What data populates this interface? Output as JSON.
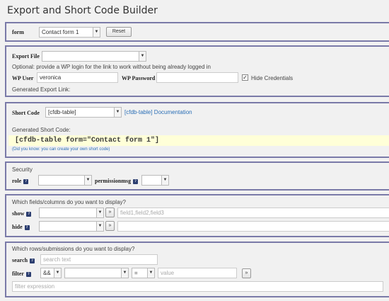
{
  "page": {
    "title": "Export and Short Code Builder"
  },
  "form_panel": {
    "form_label": "form",
    "form_value": "Contact form 1",
    "reset_label": "Reset"
  },
  "export_panel": {
    "export_file_label": "Export File",
    "export_file_value": "",
    "optional_note": "Optional: provide a WP login for the link to work without being already logged in",
    "wp_user_label": "WP User",
    "wp_user_value": "veronica",
    "wp_password_label": "WP Password",
    "wp_password_value": "",
    "hide_credentials_label": "Hide Credentials",
    "hide_credentials_checked": true,
    "generated_link_label": "Generated Export Link:"
  },
  "shortcode_panel": {
    "short_code_label": "Short Code",
    "short_code_value": "[cfdb-table]",
    "doc_link": "[cfdb-table] Documentation",
    "generated_label": "Generated Short Code:",
    "generated_code": "[cfdb-table form=\"Contact form 1\"]",
    "tip": "(Did you know: you can create your own short code)"
  },
  "security_panel": {
    "heading": "Security",
    "role_label": "role",
    "role_value": "",
    "permissionmsg_label": "permissionmsg",
    "permissionmsg_value": ""
  },
  "fields_panel": {
    "heading": "Which fields/columns do you want to display?",
    "show_label": "show",
    "show_value": "",
    "show_placeholder": "field1,field2,field3",
    "hide_label": "hide",
    "hide_value": "",
    "add_button": "»"
  },
  "rows_panel": {
    "heading": "Which rows/submissions do you want to display?",
    "search_label": "search",
    "search_placeholder": "search text",
    "filter_label": "filter",
    "filter_logic": "&&",
    "filter_field": "",
    "filter_operator": "=",
    "filter_value_placeholder": "value",
    "add_button": "»",
    "filter_expression_placeholder": "filter expression"
  },
  "icons": {
    "help": "help-icon",
    "dropdown": "chevron-down-icon"
  },
  "colors": {
    "panel_border": "#7a7aa8",
    "link": "#2b6fb6",
    "code_bg": "#ffffd8",
    "help_icon": "#2c3e70"
  }
}
